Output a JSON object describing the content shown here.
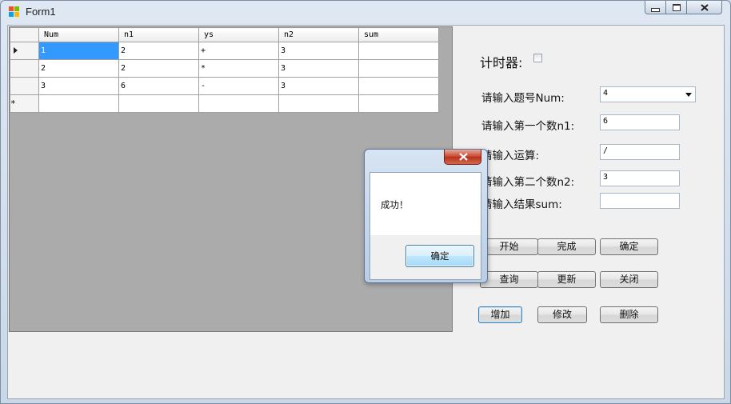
{
  "window": {
    "title": "Form1"
  },
  "grid": {
    "columns": [
      "Num",
      "n1",
      "ys",
      "n2",
      "sum"
    ],
    "rows": [
      [
        "1",
        "2",
        "+",
        "3",
        ""
      ],
      [
        "2",
        "2",
        "*",
        "3",
        ""
      ],
      [
        "3",
        "6",
        "-",
        "3",
        ""
      ],
      [
        "",
        "",
        "",
        "",
        ""
      ]
    ],
    "new_row_marker": "*"
  },
  "form": {
    "timer_label": "计时器:",
    "num_label": "请输入题号Num:",
    "num_value": "4",
    "n1_label": "请输入第一个数n1:",
    "n1_value": "6",
    "op_label": "请输入运算:",
    "op_value": "/",
    "n2_label": "请输入第二个数n2:",
    "n2_value": "3",
    "sum_label": "请输入结果sum:",
    "sum_value": ""
  },
  "buttons": {
    "start": "开始",
    "finish": "完成",
    "confirm": "确定",
    "query": "查询",
    "update": "更新",
    "close": "关闭",
    "add": "增加",
    "modify": "修改",
    "delete": "删除"
  },
  "messagebox": {
    "text": "成功！",
    "ok": "确定"
  },
  "icons": {
    "minimize": "minimize-icon",
    "maximize": "maximize-icon",
    "close": "close-icon"
  }
}
